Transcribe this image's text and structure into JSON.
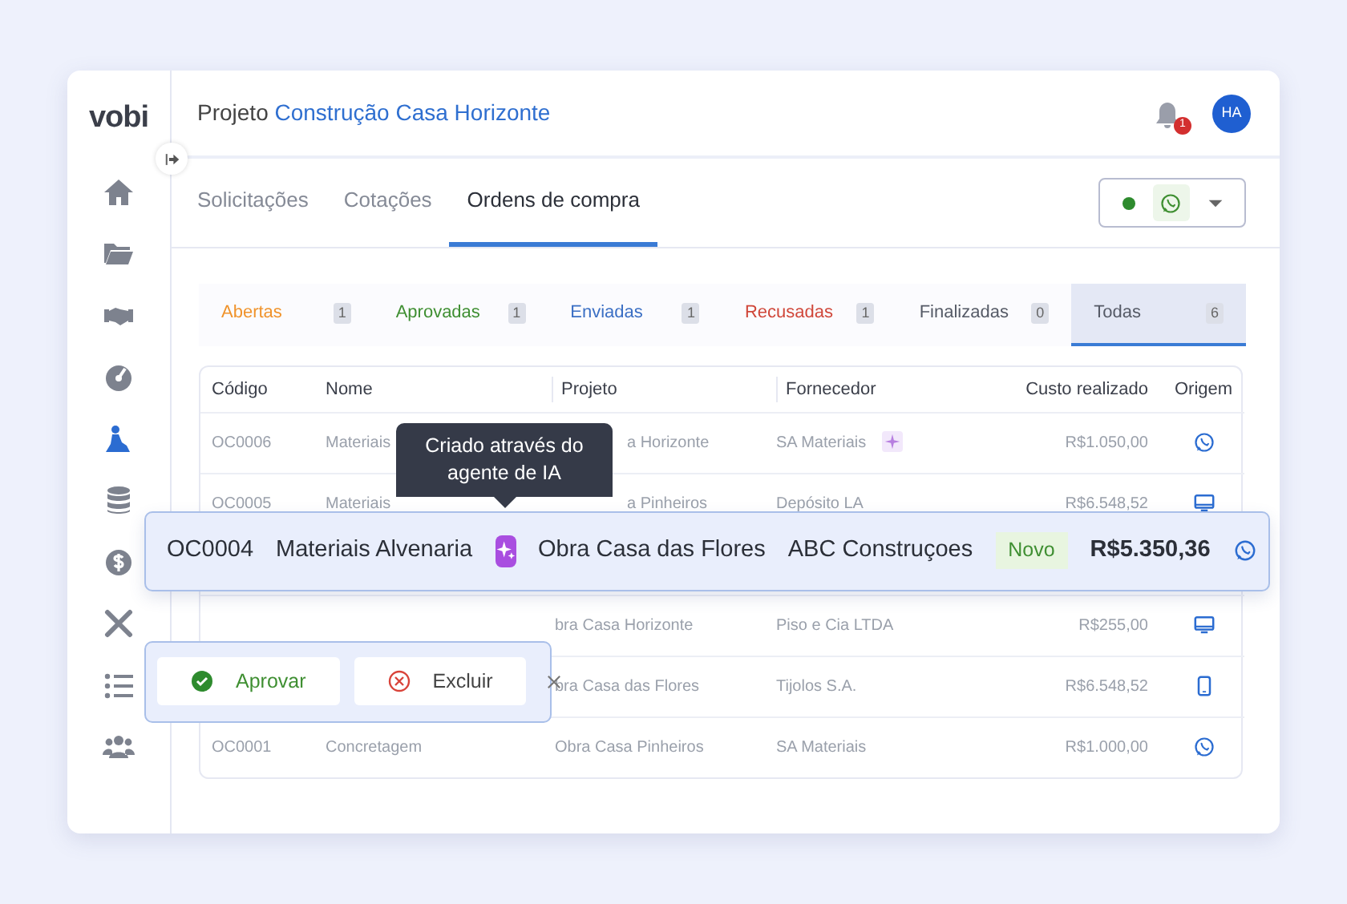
{
  "sidebar": {
    "logo": "vobi"
  },
  "header": {
    "label": "Projeto",
    "project": "Construção Casa Horizonte",
    "notification_count": "1",
    "avatar": "HA"
  },
  "tabs": [
    {
      "label": "Solicitações",
      "selected": false
    },
    {
      "label": "Cotações",
      "selected": false
    },
    {
      "label": "Ordens de compra",
      "selected": true
    }
  ],
  "channel_selector": {
    "online": true
  },
  "status_filters": [
    {
      "label": "Abertas",
      "count": "1",
      "color": "#f0932b",
      "selected": false
    },
    {
      "label": "Aprovadas",
      "count": "1",
      "color": "#3f8f32",
      "selected": false
    },
    {
      "label": "Enviadas",
      "count": "1",
      "color": "#3b6fc4",
      "selected": false
    },
    {
      "label": "Recusadas",
      "count": "1",
      "color": "#d0473a",
      "selected": false
    },
    {
      "label": "Finalizadas",
      "count": "0",
      "color": "#555a66",
      "selected": false
    },
    {
      "label": "Todas",
      "count": "6",
      "color": "#555a66",
      "selected": true
    }
  ],
  "table": {
    "columns": [
      "Código",
      "Nome",
      "Projeto",
      "Fornecedor",
      "Custo realizado",
      "Origem"
    ],
    "rows": [
      {
        "code": "OC0006",
        "name": "Materiais",
        "project": "a Horizonte",
        "supplier": "SA Materiais",
        "ai": true,
        "cost": "R$1.050,00",
        "origin": {
          "kind": "whatsapp"
        },
        "selected": false
      },
      {
        "code": "OC0005",
        "name": "Materiais",
        "project": "a Pinheiros",
        "supplier": "Depósito LA",
        "ai": false,
        "cost": "R$6.548,52",
        "origin": {
          "kind": "desktop"
        },
        "selected": false
      },
      {
        "code": "OC0004",
        "name": "Materiais Alvenaria",
        "project": "Obra Casa das Flores",
        "supplier": "ABC Construçoes",
        "ai": true,
        "tooltip": "Criado através do agente de IA",
        "status": "Novo",
        "cost": "R$5.350,36",
        "origin": {
          "kind": "whatsapp"
        },
        "selected": true,
        "actions": [
          {
            "label": "Aprovar",
            "kind": "approve"
          },
          {
            "label": "Excluir",
            "kind": "delete"
          }
        ]
      },
      {
        "project": "bra Casa Horizonte",
        "supplier": "Piso e Cia LTDA",
        "ai": false,
        "cost": "R$255,00",
        "origin": {
          "kind": "desktop"
        },
        "selected": false
      },
      {
        "project": "bra Casa das Flores",
        "supplier": "Tijolos S.A.",
        "ai": false,
        "cost": "R$6.548,52",
        "origin": {
          "kind": "mobile"
        },
        "selected": false
      },
      {
        "code": "OC0001",
        "name": "Concretagem",
        "project": "Obra Casa Pinheiros",
        "supplier": "SA Materiais",
        "ai": false,
        "cost": "R$1.000,00",
        "origin": {
          "kind": "whatsapp"
        },
        "selected": false
      }
    ]
  }
}
